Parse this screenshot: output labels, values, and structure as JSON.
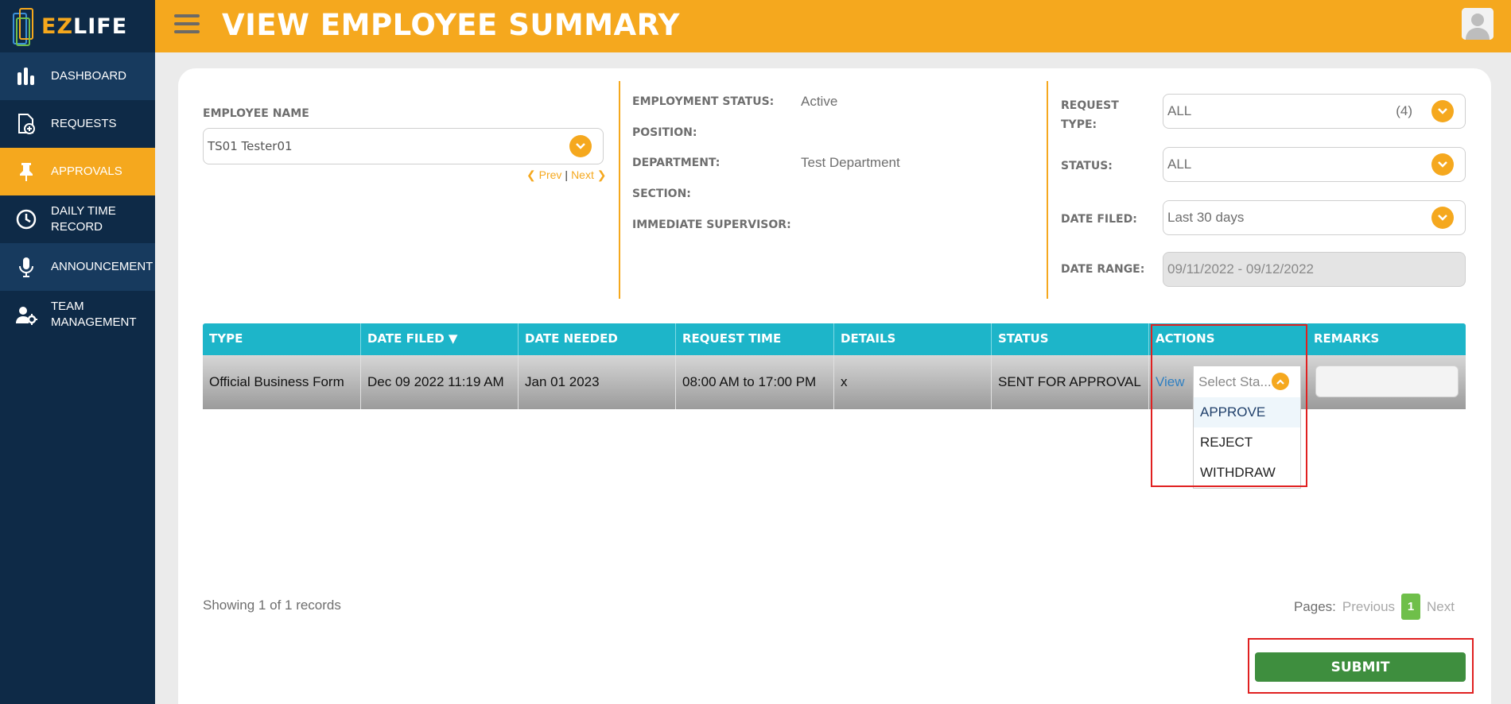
{
  "app": {
    "logo_text_accent": "EZ",
    "logo_text_main": "LIFE"
  },
  "sidebar": {
    "items": [
      {
        "label": "DASHBOARD",
        "icon": "bar-chart-icon"
      },
      {
        "label": "REQUESTS",
        "icon": "document-add-icon"
      },
      {
        "label": "APPROVALS",
        "icon": "pin-icon",
        "active": true
      },
      {
        "label_line1": "DAILY TIME",
        "label_line2": "RECORD",
        "icon": "clock-icon"
      },
      {
        "label": "ANNOUNCEMENT",
        "icon": "microphone-icon"
      },
      {
        "label_line1": "TEAM",
        "label_line2": "MANAGEMENT",
        "icon": "user-gear-icon"
      }
    ]
  },
  "header": {
    "title": "VIEW EMPLOYEE SUMMARY"
  },
  "employee": {
    "label": "EMPLOYEE NAME",
    "value": "TS01 Tester01",
    "prev": "Prev",
    "separator": "|",
    "next": "Next"
  },
  "info": {
    "employment_status_label": "EMPLOYMENT STATUS:",
    "employment_status_value": "Active",
    "position_label": "POSITION:",
    "department_label": "DEPARTMENT:",
    "department_value": "Test Department",
    "section_label": "SECTION:",
    "supervisor_label": "IMMEDIATE SUPERVISOR:"
  },
  "filters": {
    "request_type_label_1": "REQUEST",
    "request_type_label_2": "TYPE:",
    "request_type_value": "ALL",
    "request_type_count": "(4)",
    "status_label": "STATUS:",
    "status_value": "ALL",
    "date_filed_label": "DATE FILED:",
    "date_filed_value": "Last 30 days",
    "date_range_label": "DATE RANGE:",
    "date_range_value": "09/11/2022 - 09/12/2022"
  },
  "table": {
    "headers": [
      "TYPE",
      "DATE FILED ▼",
      "DATE NEEDED",
      "REQUEST TIME",
      "DETAILS",
      "STATUS",
      "ACTIONS",
      "REMARKS"
    ],
    "rows": [
      {
        "type": "Official Business Form",
        "date_filed": "Dec 09 2022 11:19 AM",
        "date_needed": "Jan 01 2023",
        "request_time": "08:00 AM to 17:00 PM",
        "details": "x",
        "status": "SENT FOR APPROVAL",
        "view_link": "View"
      }
    ]
  },
  "status_dropdown": {
    "placeholder": "Select Sta...",
    "options": [
      "APPROVE",
      "REJECT",
      "WITHDRAW"
    ]
  },
  "footer": {
    "showing": "Showing 1 of 1 records",
    "pages_label": "Pages:",
    "previous": "Previous",
    "current_page": "1",
    "next": "Next",
    "submit": "SUBMIT"
  },
  "colors": {
    "accent": "#f5a81e",
    "sidebar": "#0e2a47",
    "table_header": "#1db5c9",
    "submit": "#3e8e3e",
    "highlight_box": "#e02020"
  }
}
